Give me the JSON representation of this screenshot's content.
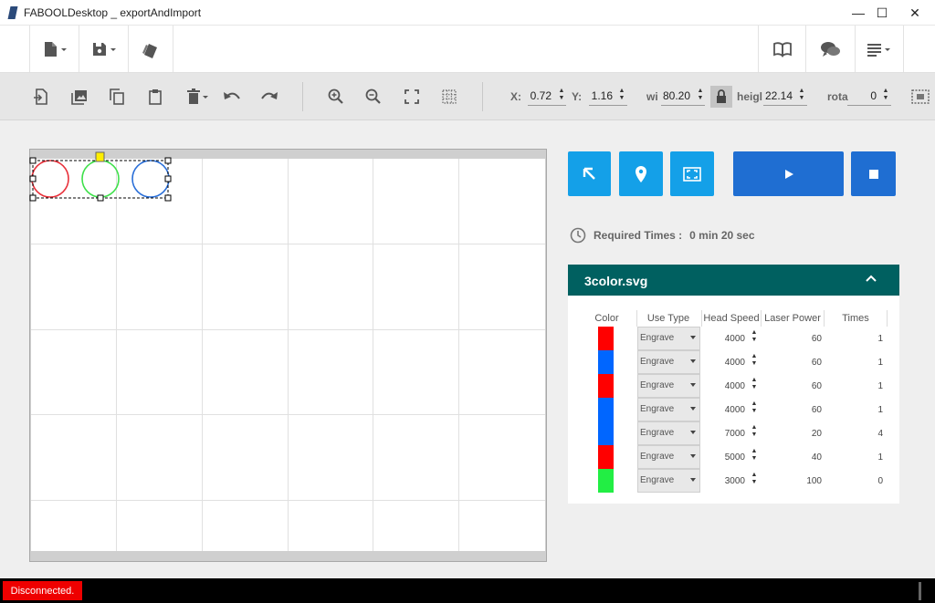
{
  "window": {
    "title": "FABOOLDesktop _ exportAndImport",
    "minimize": "—",
    "maximize": "☐",
    "close": "✕"
  },
  "toolbar_top": {
    "left_items": [
      "new-file-dropdown",
      "save-dropdown",
      "layers"
    ],
    "right_items": [
      "manual",
      "support-chat",
      "menu-dropdown"
    ]
  },
  "toolbar_edit": {
    "x_label": "X:",
    "x_value": "0.72",
    "y_label": "Y:",
    "y_value": "1.16",
    "width_label": "wi",
    "width_value": "80.20",
    "height_label": "heigl",
    "height_value": "22.14",
    "rotate_label": "rota",
    "rotate_value": "0"
  },
  "canvas": {
    "shapes": [
      {
        "name": "red-circle",
        "color": "#e8303a"
      },
      {
        "name": "green-circle",
        "color": "#3ee04a"
      },
      {
        "name": "blue-circle",
        "color": "#2a6fd8"
      }
    ],
    "handle_color": "#ffee00"
  },
  "actions": {
    "accent": "#14a0e8",
    "accent_dark": "#1f6ed2"
  },
  "required_time": {
    "label": "Required Times :",
    "value": "0 min 20 sec"
  },
  "file_panel": {
    "filename": "3color.svg",
    "header_color": "#006060",
    "columns": [
      "Color",
      "Use Type",
      "Head Speed",
      "Laser Power",
      "Times"
    ],
    "rows": [
      {
        "color": "#ff0000",
        "use_type": "Engrave",
        "speed": "4000",
        "power": "60",
        "times": "1"
      },
      {
        "color": "#0066ff",
        "use_type": "Engrave",
        "speed": "4000",
        "power": "60",
        "times": "1"
      },
      {
        "color": "#ff0000",
        "use_type": "Engrave",
        "speed": "4000",
        "power": "60",
        "times": "1"
      },
      {
        "color": "#0066ff",
        "use_type": "Engrave",
        "speed": "4000",
        "power": "60",
        "times": "1"
      },
      {
        "color": "#0066ff",
        "use_type": "Engrave",
        "speed": "7000",
        "power": "20",
        "times": "4"
      },
      {
        "color": "#ff0000",
        "use_type": "Engrave",
        "speed": "5000",
        "power": "40",
        "times": "1"
      },
      {
        "color": "#22ee44",
        "use_type": "Engrave",
        "speed": "3000",
        "power": "100",
        "times": "0"
      }
    ]
  },
  "status": {
    "connection": "Disconnected."
  }
}
